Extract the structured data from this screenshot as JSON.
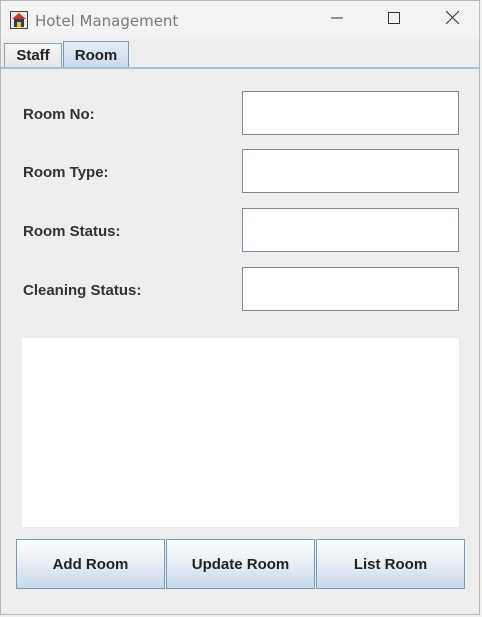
{
  "window": {
    "title": "Hotel Management"
  },
  "tabs": [
    {
      "label": "Staff",
      "selected": false
    },
    {
      "label": "Room",
      "selected": true
    }
  ],
  "form": {
    "room_no_label": "Room No:",
    "room_no_value": "",
    "room_type_label": "Room Type:",
    "room_type_value": "",
    "room_status_label": "Room Status:",
    "room_status_value": "",
    "cleaning_status_label": "Cleaning Status:",
    "cleaning_status_value": ""
  },
  "output": {
    "text": ""
  },
  "actions": {
    "add_label": "Add Room",
    "update_label": "Update Room",
    "list_label": "List Room"
  },
  "icons": {
    "app": "hotel-app-icon",
    "minimize": "minimize-icon",
    "maximize": "maximize-icon",
    "close": "close-icon"
  },
  "colors": {
    "selected_tab": "#c9d9ea",
    "button_gradient_end": "#c8d8e9",
    "border_accent": "#7b98b8"
  }
}
